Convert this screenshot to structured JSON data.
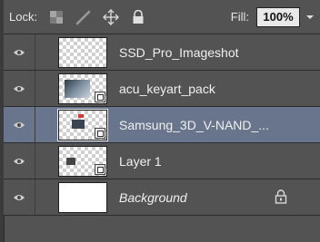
{
  "lockbar": {
    "label": "Lock:",
    "fill_label": "Fill:",
    "fill_value": "100%",
    "icons": [
      "lock-transparent-pixels-icon",
      "lock-image-pixels-icon",
      "lock-position-icon",
      "lock-all-icon",
      "dropdown-arrow-icon"
    ]
  },
  "layers": [
    {
      "name": "SSD_Pro_Imageshot",
      "visible": true,
      "selected": false,
      "smart_object": false,
      "locked": false
    },
    {
      "name": "acu_keyart_pack",
      "visible": true,
      "selected": false,
      "smart_object": true,
      "locked": false
    },
    {
      "name": "Samsung_3D_V-NAND_...",
      "visible": true,
      "selected": true,
      "smart_object": true,
      "locked": false
    },
    {
      "name": "Layer 1",
      "visible": true,
      "selected": false,
      "smart_object": true,
      "locked": false
    },
    {
      "name": "Background",
      "visible": true,
      "selected": false,
      "smart_object": false,
      "locked": true
    }
  ],
  "colors": {
    "panel_bg": "#535353",
    "selected_row": "#68758c",
    "divider": "#2c2c2c"
  }
}
